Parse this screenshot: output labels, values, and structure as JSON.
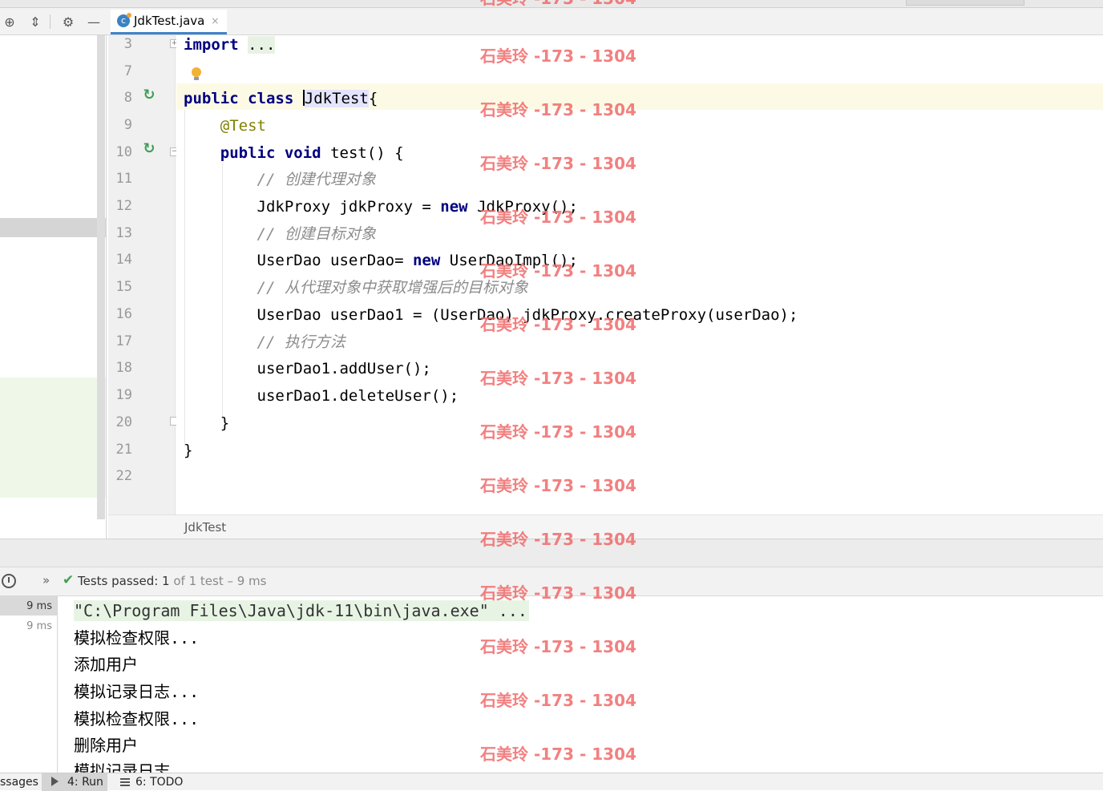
{
  "editor": {
    "tab_label": "JdkTest.java",
    "tab_close": "×",
    "breadcrumb": "JdkTest",
    "lines": [
      {
        "n": "3",
        "segments": [
          {
            "t": "import",
            "c": "kw"
          },
          {
            "t": " ",
            "c": ""
          },
          {
            "t": "...",
            "c": "fold-text"
          }
        ]
      },
      {
        "n": "7",
        "segments": []
      },
      {
        "n": "8",
        "segments": [
          {
            "t": "public",
            "c": "kw"
          },
          {
            "t": " ",
            "c": ""
          },
          {
            "t": "class",
            "c": "kw"
          },
          {
            "t": " ",
            "c": ""
          },
          {
            "t": "JdkTest",
            "c": "hl-ident"
          },
          {
            "t": "{",
            "c": ""
          }
        ]
      },
      {
        "n": "9",
        "segments": [
          {
            "t": "    ",
            "c": ""
          },
          {
            "t": "@Test",
            "c": "ann"
          }
        ]
      },
      {
        "n": "10",
        "segments": [
          {
            "t": "    ",
            "c": ""
          },
          {
            "t": "public",
            "c": "kw"
          },
          {
            "t": " ",
            "c": ""
          },
          {
            "t": "void",
            "c": "kw"
          },
          {
            "t": " test() {",
            "c": ""
          }
        ]
      },
      {
        "n": "11",
        "segments": [
          {
            "t": "        ",
            "c": ""
          },
          {
            "t": "// 创建代理对象",
            "c": "cmt"
          }
        ]
      },
      {
        "n": "12",
        "segments": [
          {
            "t": "        JdkProxy jdkProxy = ",
            "c": ""
          },
          {
            "t": "new",
            "c": "kw"
          },
          {
            "t": " JdkProxy();",
            "c": ""
          }
        ]
      },
      {
        "n": "13",
        "segments": [
          {
            "t": "        ",
            "c": ""
          },
          {
            "t": "// 创建目标对象",
            "c": "cmt"
          }
        ]
      },
      {
        "n": "14",
        "segments": [
          {
            "t": "        UserDao userDao= ",
            "c": ""
          },
          {
            "t": "new",
            "c": "kw"
          },
          {
            "t": " UserDaoImpl();",
            "c": ""
          }
        ]
      },
      {
        "n": "15",
        "segments": [
          {
            "t": "        ",
            "c": ""
          },
          {
            "t": "// 从代理对象中获取增强后的目标对象",
            "c": "cmt"
          }
        ]
      },
      {
        "n": "16",
        "segments": [
          {
            "t": "        UserDao userDao1 = (UserDao) jdkProxy.createProxy(userDao);",
            "c": ""
          }
        ]
      },
      {
        "n": "17",
        "segments": [
          {
            "t": "        ",
            "c": ""
          },
          {
            "t": "// 执行方法",
            "c": "cmt"
          }
        ]
      },
      {
        "n": "18",
        "segments": [
          {
            "t": "        userDao1.addUser();",
            "c": ""
          }
        ]
      },
      {
        "n": "19",
        "segments": [
          {
            "t": "        userDao1.deleteUser();",
            "c": ""
          }
        ]
      },
      {
        "n": "20",
        "segments": [
          {
            "t": "    }",
            "c": ""
          }
        ]
      },
      {
        "n": "21",
        "segments": [
          {
            "t": "}",
            "c": ""
          }
        ]
      },
      {
        "n": "22",
        "segments": []
      }
    ]
  },
  "run": {
    "status_prefix": "Tests passed: 1",
    "status_suffix": " of 1 test – 9 ms",
    "more": "»",
    "times": [
      "9 ms",
      "9 ms"
    ],
    "output": [
      "\"C:\\Program Files\\Java\\jdk-11\\bin\\java.exe\" ...",
      "模拟检查权限...",
      "添加用户",
      "模拟记录日志...",
      "模拟检查权限...",
      "删除用户",
      "模拟记录日志..."
    ]
  },
  "bottom_bar": {
    "messages_label": "ssages",
    "run_label": "4: Run",
    "todo_label": "6: TODO"
  },
  "watermark": "石美玲 -173 - 1304",
  "icons": {
    "toolbar": [
      "target-icon",
      "collapse-icon",
      "gear-icon",
      "minimize-icon"
    ],
    "gutter_run": "run-test-icon",
    "intention": "lightbulb-icon"
  }
}
